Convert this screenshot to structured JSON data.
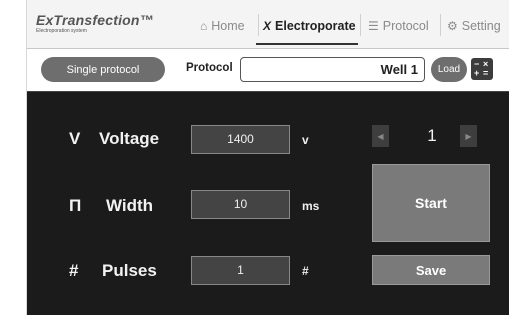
{
  "brand": {
    "title": "ExTransfection™",
    "subtitle": "Electroporation system"
  },
  "nav": {
    "items": [
      {
        "label": "Home",
        "icon": "⌂",
        "icon_name": "home-icon",
        "active": false
      },
      {
        "label": "Electroporate",
        "icon": "X",
        "icon_name": "electroporate-icon",
        "active": true
      },
      {
        "label": "Protocol",
        "icon": "☰",
        "icon_name": "list-icon",
        "active": false
      },
      {
        "label": "Setting",
        "icon": "⚙",
        "icon_name": "gear-icon",
        "active": false
      }
    ]
  },
  "protocol_bar": {
    "mode_button": "Single protocol",
    "label": "Protocol",
    "value": "Well 1",
    "load_button": "Load",
    "calc_icon": "calculator-icon"
  },
  "parameters": [
    {
      "symbol": "V",
      "label": "Voltage",
      "value": "1400",
      "unit": "v"
    },
    {
      "symbol": "Π",
      "label": "Width",
      "value": "10",
      "unit": "ms"
    },
    {
      "symbol": "#",
      "label": "Pulses",
      "value": "1",
      "unit": "#"
    }
  ],
  "pager": {
    "current": "1",
    "prev_icon": "◀",
    "next_icon": "▶"
  },
  "actions": {
    "start": "Start",
    "save": "Save"
  },
  "colors": {
    "panel_bg": "#1b1b1b",
    "button_gray": "#7a7a7a",
    "field_bg": "#444444",
    "nav_active": "#222222",
    "nav_inactive": "#8a8a8a"
  }
}
